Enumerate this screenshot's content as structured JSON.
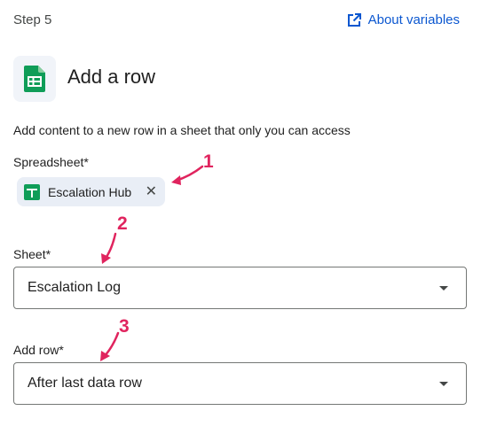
{
  "header": {
    "step_label": "Step 5",
    "about_link": "About variables"
  },
  "action": {
    "title": "Add a row",
    "app_icon": "google-sheets-icon",
    "description": "Add content to a new row in a sheet that only you can access"
  },
  "fields": {
    "spreadsheet": {
      "label": "Spreadsheet*",
      "chip_label": "Escalation Hub",
      "chip_icon": "google-sheets-icon",
      "remove_icon": "close-icon"
    },
    "sheet": {
      "label": "Sheet*",
      "value": "Escalation Log"
    },
    "add_row": {
      "label": "Add row*",
      "value": "After last data row"
    }
  },
  "annotations": [
    "1",
    "2",
    "3"
  ],
  "colors": {
    "link": "#0b57d0",
    "annotation": "#e0245e",
    "sheets_green": "#0f9d58",
    "chip_bg": "#e9eef6"
  }
}
